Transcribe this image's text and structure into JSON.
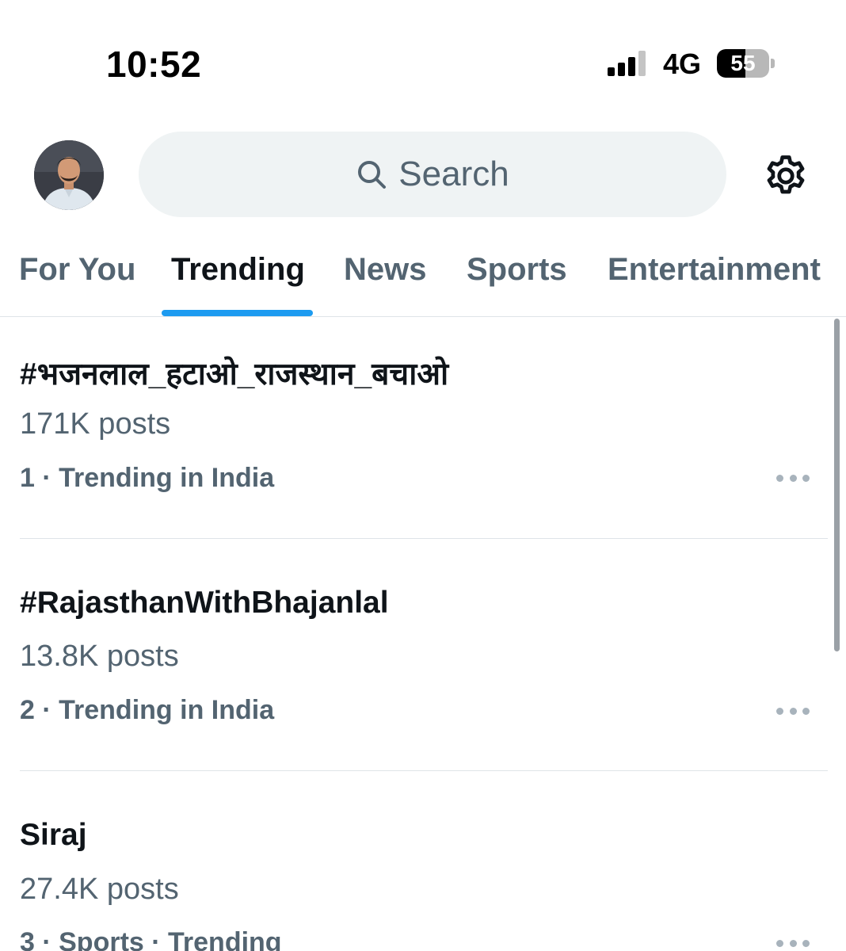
{
  "status_bar": {
    "time": "10:52",
    "network": "4G",
    "battery_level": "55",
    "battery_fraction": 0.55
  },
  "header": {
    "search_placeholder": "Search"
  },
  "tabs": [
    {
      "label": "For You",
      "active": false
    },
    {
      "label": "Trending",
      "active": true
    },
    {
      "label": "News",
      "active": false
    },
    {
      "label": "Sports",
      "active": false
    },
    {
      "label": "Entertainment",
      "active": false
    }
  ],
  "trends": [
    {
      "title": "#भजनलाल_हटाओ_राजस्थान_बचाओ",
      "posts": "171K posts",
      "context": "1 · Trending in India"
    },
    {
      "title": "#RajasthanWithBhajanlal",
      "posts": "13.8K posts",
      "context": "2 · Trending in India"
    },
    {
      "title": "Siraj",
      "posts": "27.4K posts",
      "context": "3 · Sports · Trending"
    }
  ],
  "colors": {
    "accent": "#1d9bf0",
    "secondary_text": "#536471",
    "search_bg": "#eff3f4"
  }
}
